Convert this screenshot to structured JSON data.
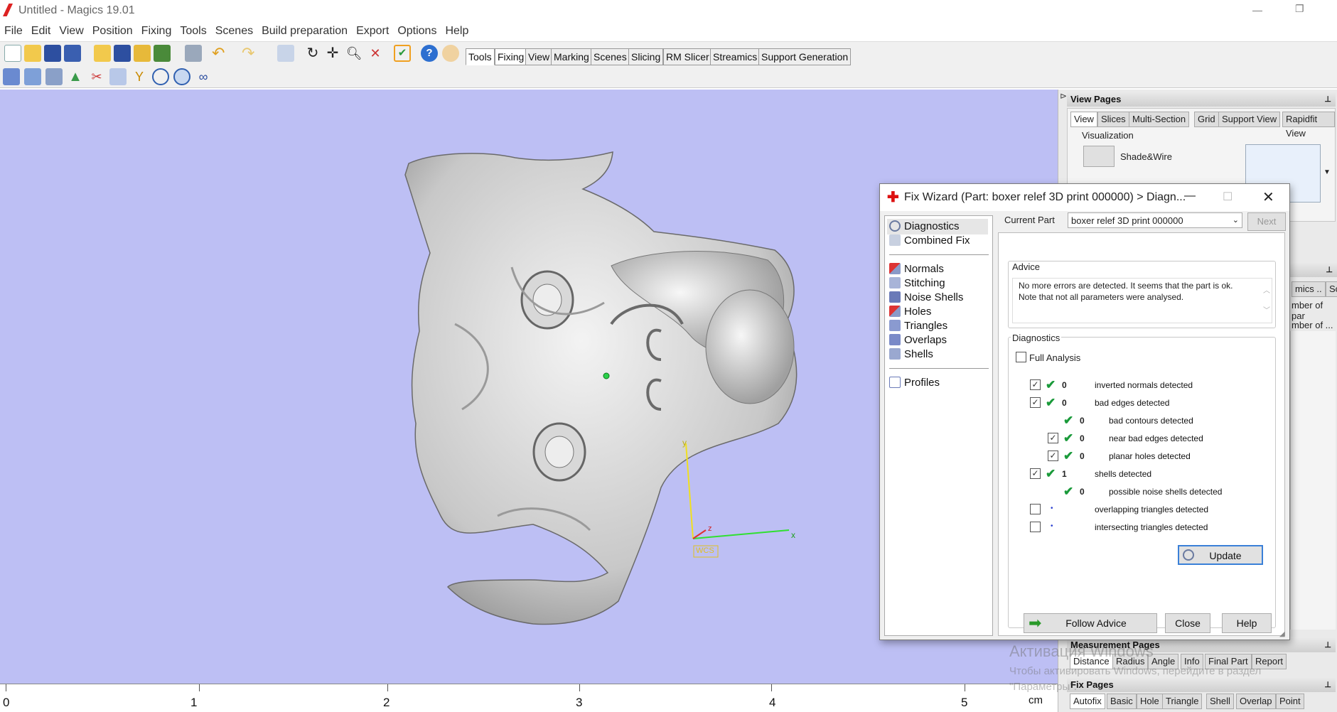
{
  "window": {
    "title": "Untitled - Magics 19.01"
  },
  "menu": [
    "File",
    "Edit",
    "View",
    "Position",
    "Fixing",
    "Tools",
    "Scenes",
    "Build preparation",
    "Export",
    "Options",
    "Help"
  ],
  "toolbar_tabs": [
    "Tools",
    "Fixing",
    "View",
    "Marking",
    "Scenes",
    "Slicing",
    "RM Slicer",
    "Streamics",
    "Support Generation"
  ],
  "ruler": {
    "labels": [
      "0",
      "1",
      "2",
      "3",
      "4",
      "5"
    ],
    "unit": "cm"
  },
  "viewport": {
    "axes": {
      "x": "x",
      "y": "y",
      "z": "z",
      "wcs": "WCS"
    }
  },
  "view_pages": {
    "title": "View Pages",
    "tabs": [
      "View",
      "Slices",
      "Multi-Section",
      "Grid",
      "Support View",
      "Rapidfit View"
    ],
    "visualization_label": "Visualization",
    "mode": "Shade&Wire",
    "hidden_fragments": [
      "mics ..",
      "Sc",
      "mber of par",
      "mber of ..."
    ]
  },
  "measurement_pages": {
    "title": "Measurement Pages",
    "tabs": [
      "Distance",
      "Radius",
      "Angle",
      "Info",
      "Final Part",
      "Report"
    ]
  },
  "fix_pages": {
    "title": "Fix Pages",
    "tabs": [
      "Autofix",
      "Basic",
      "Hole",
      "Triangle",
      "Shell",
      "Overlap",
      "Point"
    ]
  },
  "watermark": {
    "line1": "Активация Windows",
    "line2": "Чтобы активировать Windows, перейдите в раздел",
    "line3": "\"Параметры\"."
  },
  "dialog": {
    "title": "Fix Wizard (Part: boxer relef 3D print 000000) > Diagn...",
    "nav_top": [
      "Diagnostics",
      "Combined Fix"
    ],
    "nav_tools": [
      "Normals",
      "Stitching",
      "Noise Shells",
      "Holes",
      "Triangles",
      "Overlaps",
      "Shells"
    ],
    "nav_bottom": [
      "Profiles"
    ],
    "current_part_label": "Current Part",
    "current_part_value": "boxer relef 3D print 000000",
    "next_label": "Next",
    "advice_label": "Advice",
    "advice_text": "No more errors are detected. It seems that the part is ok. Note that not all parameters were analysed.",
    "diagnostics_label": "Diagnostics",
    "full_analysis": "Full Analysis",
    "rows": [
      {
        "checkbox": true,
        "checked": true,
        "status": "ok",
        "count": "0",
        "label": "inverted normals detected",
        "indent": 0
      },
      {
        "checkbox": true,
        "checked": true,
        "status": "ok",
        "count": "0",
        "label": "bad edges detected",
        "indent": 0
      },
      {
        "checkbox": false,
        "checked": false,
        "status": "ok",
        "count": "0",
        "label": "bad contours detected",
        "indent": 1
      },
      {
        "checkbox": true,
        "checked": true,
        "status": "ok",
        "count": "0",
        "label": "near bad edges detected",
        "indent": 1
      },
      {
        "checkbox": true,
        "checked": true,
        "status": "ok",
        "count": "0",
        "label": "planar holes detected",
        "indent": 1
      },
      {
        "checkbox": true,
        "checked": true,
        "status": "ok",
        "count": "1",
        "label": "shells detected",
        "indent": 0
      },
      {
        "checkbox": false,
        "checked": false,
        "status": "ok",
        "count": "0",
        "label": "possible noise shells detected",
        "indent": 1
      },
      {
        "checkbox": true,
        "checked": false,
        "status": "none",
        "count": "",
        "label": "overlapping triangles detected",
        "indent": 0
      },
      {
        "checkbox": true,
        "checked": false,
        "status": "none",
        "count": "",
        "label": "intersecting triangles detected",
        "indent": 0
      }
    ],
    "update_label": "Update",
    "follow_advice_label": "Follow Advice",
    "close_label": "Close",
    "help_label": "Help"
  }
}
